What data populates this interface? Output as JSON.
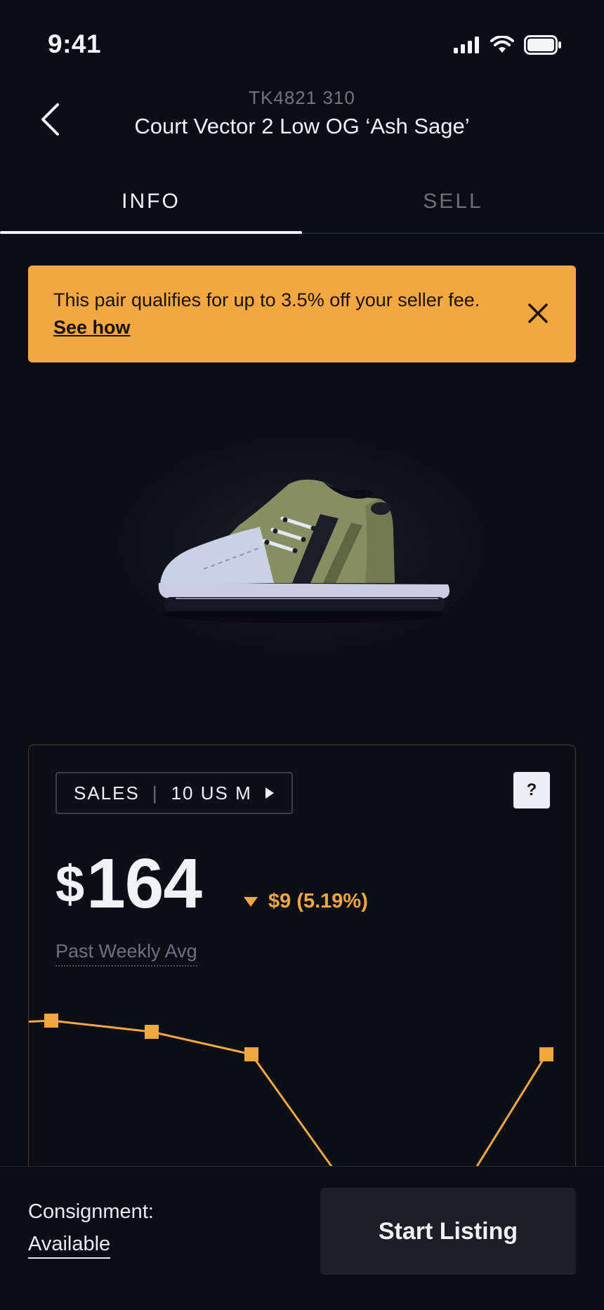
{
  "status_bar": {
    "time": "9:41",
    "icons": [
      "signal-icon",
      "wifi-icon",
      "battery-icon"
    ]
  },
  "header": {
    "sku": "TK4821 310",
    "title": "Court Vector 2 Low OG ‘Ash Sage’",
    "back_icon": "chevron-left-icon"
  },
  "tabs": [
    {
      "label": "INFO",
      "active": true
    },
    {
      "label": "SELL",
      "active": false
    }
  ],
  "banner": {
    "text": "This pair qualifies for up to 3.5% off your seller fee.",
    "link": "See how",
    "close_icon": "close-icon",
    "color": "#f2a741"
  },
  "stats": {
    "selector_label": "SALES",
    "size": "10 US M",
    "help_label": "?",
    "price_currency": "$",
    "price_value": "164",
    "change": "$9 (5.19%)",
    "change_direction": "down",
    "avg_label": "Past Weekly Avg",
    "accent_color": "#f2a741"
  },
  "chart_data": {
    "type": "line",
    "title": "",
    "xlabel": "",
    "ylabel": "",
    "series": [
      {
        "values": [
          171,
          169,
          165,
          140,
          138,
          165
        ]
      }
    ],
    "ylim": [
      130,
      180
    ],
    "grid": false
  },
  "footer": {
    "consignment_label": "Consignment:",
    "consignment_value": "Available",
    "cta_label": "Start Listing"
  }
}
